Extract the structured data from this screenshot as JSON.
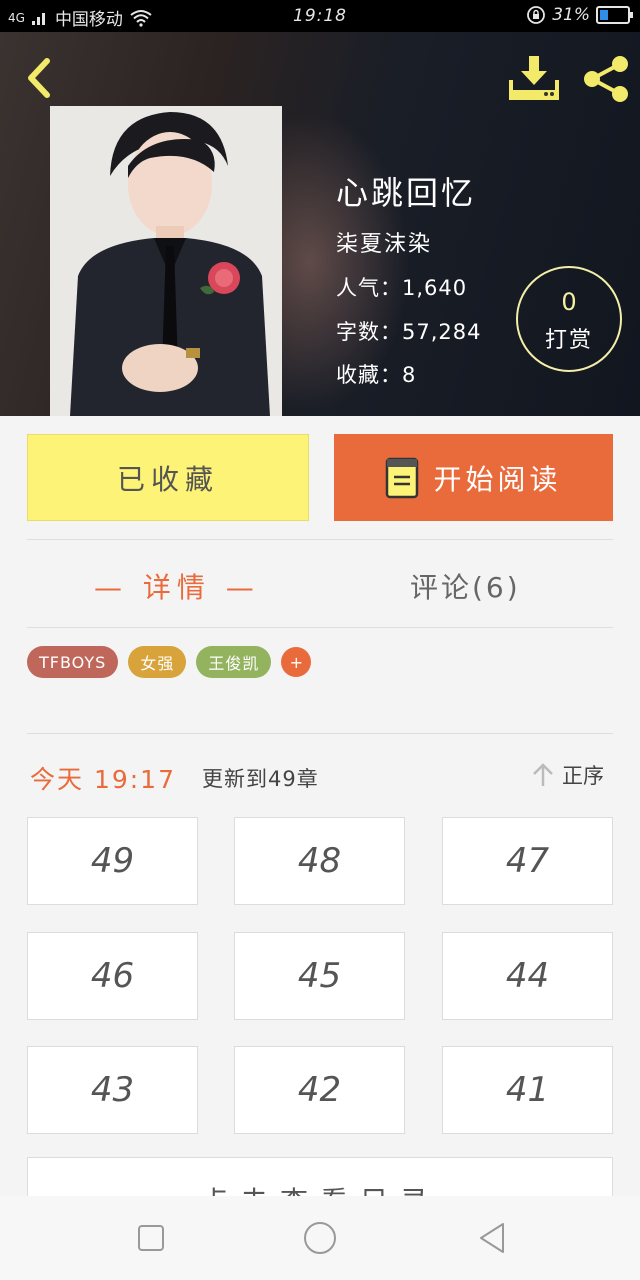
{
  "status_bar": {
    "network": "4G",
    "carrier": "中国移动",
    "time": "19:18",
    "battery_percent": "31%",
    "battery_level": 0.31
  },
  "book": {
    "title": "心跳回忆",
    "author": "柒夏沫染",
    "popularity": "人气：1,640",
    "word_count": "字数：57,284",
    "favorites": "收藏：8",
    "reward_count": "0",
    "reward_label": "打赏"
  },
  "actions": {
    "favorite_label": "已收藏",
    "read_label": "开始阅读"
  },
  "tabs": {
    "details": "— 详情 —",
    "comments": "评论(6)"
  },
  "tags": [
    {
      "label": "TFBOYS",
      "color": "#c0675b"
    },
    {
      "label": "女强",
      "color": "#d7a33a"
    },
    {
      "label": "王俊凯",
      "color": "#93b35f"
    }
  ],
  "tag_add": "+",
  "update": {
    "time": "今天 19:17",
    "text": "更新到49章",
    "sort_label": "正序"
  },
  "chapters": [
    "49",
    "48",
    "47",
    "46",
    "45",
    "44",
    "43",
    "42",
    "41"
  ],
  "catalog_label": "点击查看目录",
  "colors": {
    "accent": "#e96b3c",
    "favorite_button": "#fdf377",
    "reward_ring": "#f3eea8"
  }
}
